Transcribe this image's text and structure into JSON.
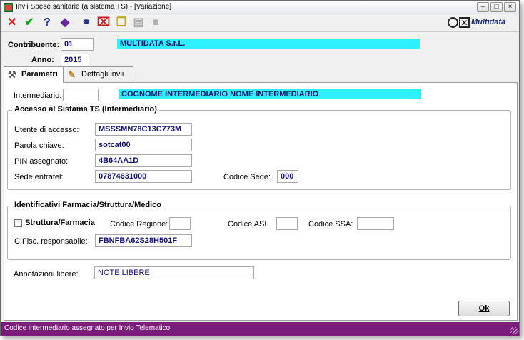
{
  "window": {
    "title": "Invii Spese sanitarie (a sistema TS) - [Variazione]"
  },
  "toolbar": {
    "icons": [
      "close-x-icon",
      "confirm-check-icon",
      "help-icon",
      "diamond-tool-icon",
      "binoculars-icon",
      "delete-record-icon",
      "copy-icon",
      "paste-icon",
      "disabled-icon"
    ],
    "logo_text": "Multidata"
  },
  "header": {
    "contribuente_label": "Contribuente:",
    "contribuente_value": "01",
    "contribuente_name": "MULTIDATA S.r.L.",
    "anno_label": "Anno:",
    "anno_value": "2015"
  },
  "tabs": [
    {
      "label": "Parametri",
      "active": true
    },
    {
      "label": "Dettagli invii",
      "active": false
    }
  ],
  "intermediario": {
    "label": "Intermediario:",
    "value": "",
    "name": "COGNOME INTERMEDIARIO NOME INTERMEDIARIO"
  },
  "accesso": {
    "title": "Accesso al Sistama TS (Intermediario)",
    "utente_label": "Utente di accesso:",
    "utente_value": "MSSSMN78C13C773M",
    "parola_label": "Parola chiave:",
    "parola_value": "sotcat00",
    "pin_label": "PIN assegnato:",
    "pin_value": "4B64AA1D",
    "sede_label": "Sede entratel:",
    "sede_value": "07874631000",
    "codice_sede_label": "Codice Sede:",
    "codice_sede_value": "000"
  },
  "identificativi": {
    "title": "Identificativi Farmacia/Struttura/Medico",
    "struttura_label": "Struttura/Farmacia",
    "struttura_checked": false,
    "regione_label": "Codice Regione:",
    "regione_value": "",
    "asl_label": "Codice ASL",
    "asl_value": "",
    "ssa_label": "Codice SSA:",
    "ssa_value": "",
    "cf_label": "C.Fisc. responsabile:",
    "cf_value": "FBNFBA62S28H501F"
  },
  "annotazioni": {
    "label": "Annotazioni libere:",
    "value": "NOTE LIBERE"
  },
  "buttons": {
    "ok_label": "Ok"
  },
  "status": {
    "text": "Codice intermediario assegnato per Invio Telematico",
    "color": "#7a1d7a"
  }
}
